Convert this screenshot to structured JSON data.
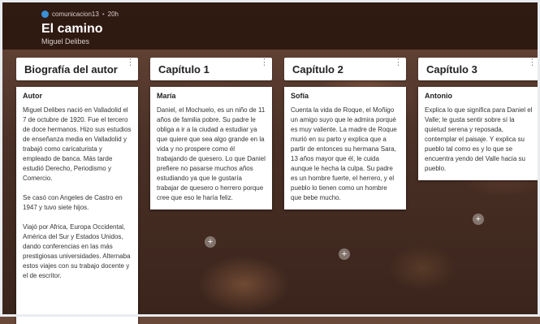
{
  "header": {
    "author_handle": "comunicacion13",
    "separator": "•",
    "time": "20h",
    "title": "El camino",
    "subtitle": "Miguel Delibes"
  },
  "columns": [
    {
      "label": "Biografía del autor",
      "cards": [
        {
          "title": "Autor",
          "body": "Miguel Delibes nació en Valladolid el 7 de octubre de 1920. Fue el tercero de doce hermanos. Hizo sus estudios de enseñanza media en Valladolid y trabajó como caricaturista y empleado de banca. Más tarde estudió Derecho, Periodismo y Comercio.\n\nSe casó con Angeles de Castro en 1947 y tuvo siete hijos.\n\nViajó por Africa, Europa Occidental, América del Sur y Estados Unidos, dando conferencias en las más prestigiosas universidades. Alternaba estos viajes con su trabajo docente y el de escritor."
        }
      ]
    },
    {
      "label": "Capítulo 1",
      "cards": [
        {
          "title": "María",
          "body": "Daniel, el Mochuelo, es un niño de 11 años de familia pobre. Su padre le obliga a ir a la ciudad a estudiar ya que quiere que sea algo grande en la vida y no prospere como él trabajando de quesero. Lo que Daniel prefiere no pasarse muchos años estudiando ya que le gustaría trabajar de quesero o herrero porque cree que eso le haría feliz."
        }
      ]
    },
    {
      "label": "Capítulo 2",
      "cards": [
        {
          "title": "Sofía",
          "body": "Cuenta la vida de Roque, el Moñigo un amigo suyo que le admira porqué es muy valiente. La madre de Roque murió en su parto y explica que a partir de entonces su hermana Sara, 13 años mayor que él, le cuida aunque le hecha la culpa. Su padre es un hombre fuerte, el herrero, y el pueblo lo tienen como un hombre que bebe mucho."
        }
      ]
    },
    {
      "label": "Capítulo 3",
      "cards": [
        {
          "title": "Antonio",
          "body": "Explica lo que significa para Daniel el Valle; le gusta sentir sobre sí la quietud serena y reposada, contemplar el paisaje. Y explica su pueblo tal como es y lo que se encuentra yendo del Valle hacia su pueblo."
        }
      ]
    }
  ],
  "icons": {
    "more": "more-vertical-icon",
    "add": "plus-icon",
    "avatar": "avatar-icon"
  },
  "add_symbol": "+",
  "more_symbol": "⋮"
}
